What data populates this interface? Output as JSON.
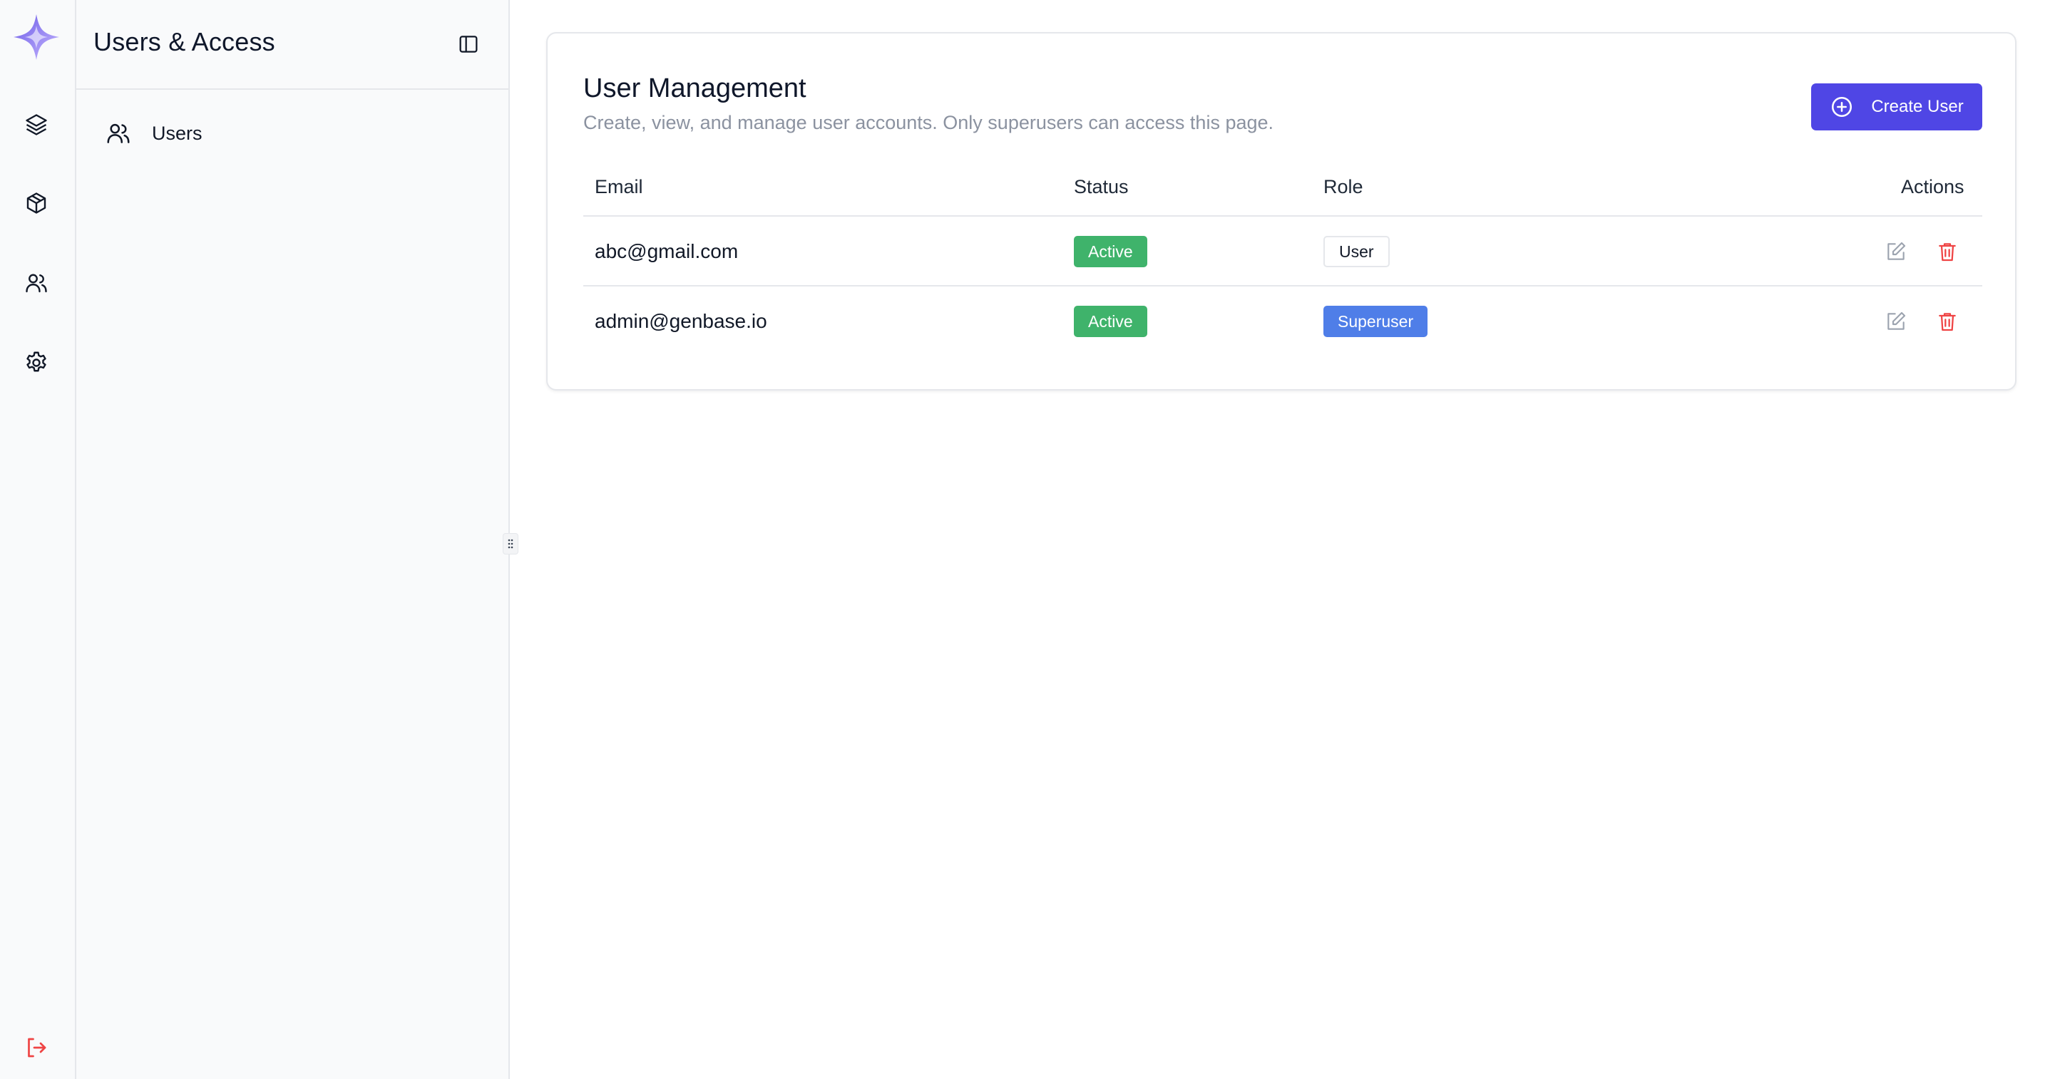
{
  "sidebar": {
    "title": "Users & Access",
    "items": [
      {
        "label": "Users",
        "icon": "users-icon"
      }
    ]
  },
  "rail": {
    "icons": [
      "logo-star",
      "layers-icon",
      "box-icon",
      "users-icon",
      "gear-icon",
      "logout-icon"
    ]
  },
  "main": {
    "title": "User Management",
    "subtitle": "Create, view, and manage user accounts. Only superusers can access this page.",
    "create_button": "Create User",
    "columns": {
      "email": "Email",
      "status": "Status",
      "role": "Role",
      "actions": "Actions"
    },
    "rows": [
      {
        "email": "abc@gmail.com",
        "status": "Active",
        "role": "User"
      },
      {
        "email": "admin@genbase.io",
        "status": "Active",
        "role": "Superuser"
      }
    ]
  },
  "colors": {
    "accent": "#4f46e5",
    "active": "#3fb36b",
    "superuser": "#4f7ee8",
    "danger": "#ef4444",
    "logout": "#ef4444"
  }
}
